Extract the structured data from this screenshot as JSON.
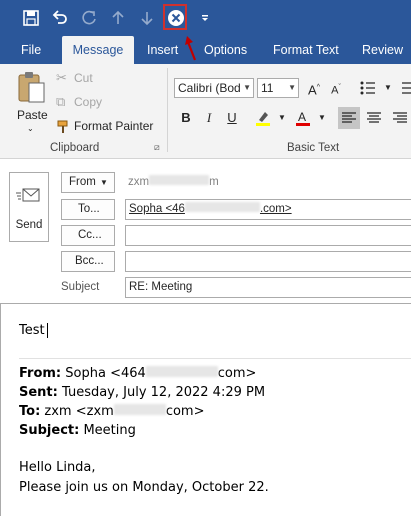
{
  "colors": {
    "accent": "#2b579a",
    "highlight": "#d0312d",
    "ribbon": "#f3f3f3"
  },
  "qat": {
    "icons": [
      "save-icon",
      "undo-icon",
      "redo-icon",
      "up-arrow-icon",
      "down-arrow-icon",
      "close-circle-icon",
      "customize-dropdown-icon"
    ]
  },
  "tabs": {
    "file": "File",
    "message": "Message",
    "insert": "Insert",
    "options": "Options",
    "format_text": "Format Text",
    "review": "Review"
  },
  "clipboard": {
    "paste": "Paste",
    "cut": "Cut",
    "copy": "Copy",
    "format_painter": "Format Painter",
    "group_label": "Clipboard"
  },
  "basic_text": {
    "font": "Calibri (Bod",
    "size": "11",
    "group_label": "Basic Text"
  },
  "compose": {
    "send": "Send",
    "from_label": "From",
    "from_value": "zxm",
    "from_value_end": "m",
    "to_label": "To...",
    "to_value": "Sopha <46",
    "to_value_end": ".com>",
    "cc_label": "Cc...",
    "bcc_label": "Bcc...",
    "subject_label": "Subject",
    "subject_value": "RE: Meeting"
  },
  "body": {
    "typed": "Test",
    "from_label": "From:",
    "from_value": " Sopha <464",
    "from_value_end": "com>",
    "sent_label": "Sent:",
    "sent_value": " Tuesday, July 12, 2022 4:29 PM",
    "to_label": "To:",
    "to_value": " zxm <zxm",
    "to_value_end": "com>",
    "subject_label": "Subject:",
    "subject_value": " Meeting",
    "greeting": "Hello Linda,",
    "message": "Please join us on Monday, October 22."
  }
}
